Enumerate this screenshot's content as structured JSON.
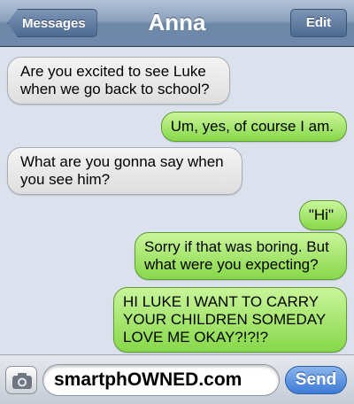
{
  "header": {
    "back_label": "Messages",
    "title": "Anna",
    "edit_label": "Edit"
  },
  "messages": [
    {
      "from": "them",
      "text": "Are you excited to see Luke\nwhen we go back to school?"
    },
    {
      "from": "me",
      "text": "Um, yes, of course I am."
    },
    {
      "from": "them",
      "text": "What are you gonna say when\nyou see him?"
    },
    {
      "from": "me",
      "text": "\"Hi\""
    },
    {
      "from": "me",
      "text": "Sorry if that was boring. But\nwhat were you expecting?"
    },
    {
      "from": "me",
      "text": "HI LUKE I WANT TO CARRY\nYOUR CHILDREN SOMEDAY\nLOVE ME OKAY?!?!?"
    }
  ],
  "composer": {
    "text": "smartphOWNED.com",
    "send_label": "Send",
    "camera_icon": "camera-icon"
  },
  "colors": {
    "sent_bubble": "#87d84a",
    "received_bubble": "#e6e6e6",
    "send_button": "#3c7bd6"
  }
}
